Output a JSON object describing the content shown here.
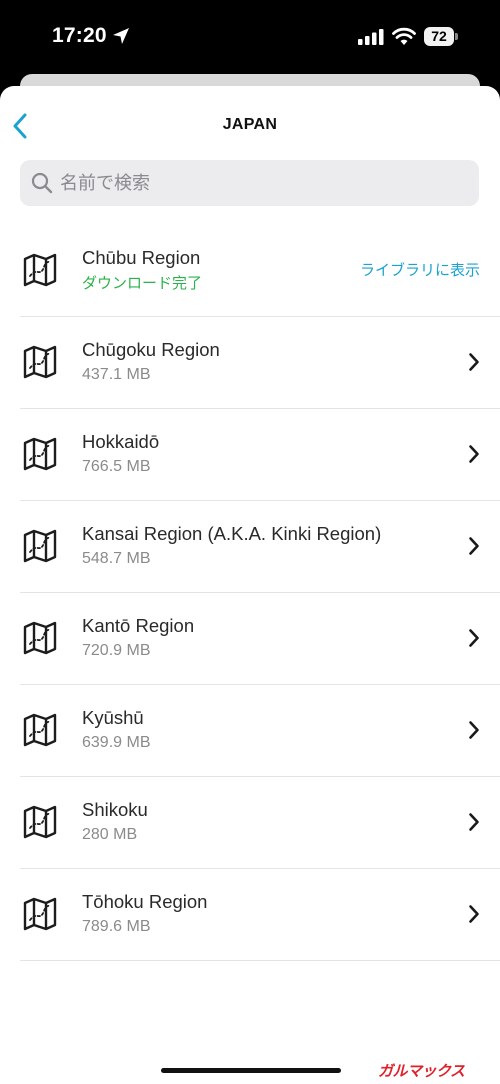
{
  "status_bar": {
    "time": "17:20",
    "battery": "72"
  },
  "header": {
    "title": "JAPAN"
  },
  "search": {
    "placeholder": "名前で検索"
  },
  "regions": [
    {
      "name": "Chūbu Region",
      "status": "ダウンロード完了",
      "action": "ライブラリに表示",
      "downloaded": true
    },
    {
      "name": "Chūgoku Region",
      "size": "437.1 MB"
    },
    {
      "name": "Hokkaidō",
      "size": "766.5 MB"
    },
    {
      "name": "Kansai Region (A.K.A. Kinki Region)",
      "size": "548.7 MB"
    },
    {
      "name": "Kantō Region",
      "size": "720.9 MB"
    },
    {
      "name": "Kyūshū",
      "size": "639.9 MB"
    },
    {
      "name": "Shikoku",
      "size": "280 MB"
    },
    {
      "name": "Tōhoku Region",
      "size": "789.6 MB"
    }
  ],
  "watermark": "ガルマックス",
  "colors": {
    "accent": "#1aa3cf",
    "success": "#2bb24c"
  }
}
